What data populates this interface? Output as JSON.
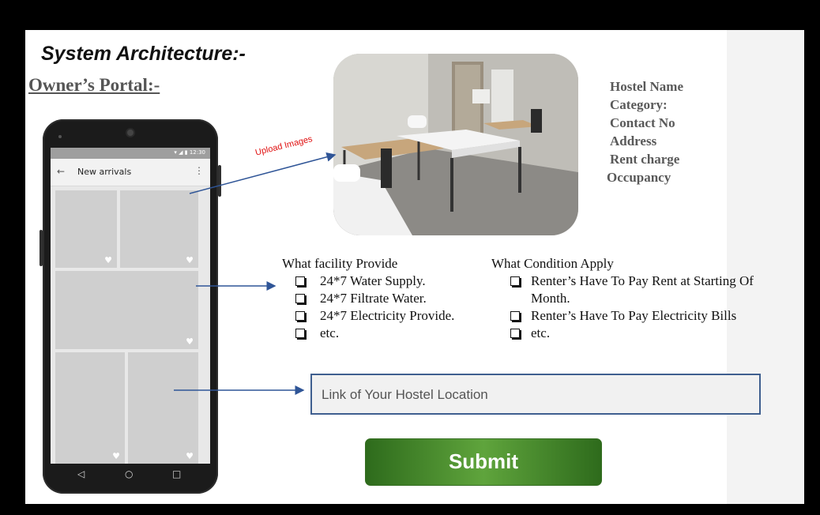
{
  "slide": {
    "heading": "System Architecture:-",
    "subheading": "Owner’s Portal:-"
  },
  "phone": {
    "status_time": "12:30",
    "appbar_title": "New arrivals",
    "back_icon": "arrow-left-icon",
    "more_icon": "more-vertical-icon"
  },
  "upload_label": "Upload Images",
  "hostel_details": [
    "Hostel Name",
    "Category:",
    "Contact No",
    "Address",
    "Rent charge",
    "Occupancy"
  ],
  "facility": {
    "title": "What facility Provide",
    "items": [
      "24*7 Water Supply.",
      "24*7 Filtrate Water.",
      "24*7 Electricity Provide.",
      "etc."
    ]
  },
  "condition": {
    "title": "What Condition Apply",
    "items": [
      "Renter’s Have To Pay Rent at Starting Of Month.",
      "Renter’s Have To Pay Electricity Bills",
      "etc."
    ]
  },
  "location": {
    "placeholder": "Link of Your Hostel Location"
  },
  "submit": {
    "label": "Submit"
  },
  "colors": {
    "frame": "#000000",
    "arrow": "#2f5597",
    "submit_green": "#4a8a2e",
    "upload_label": "#e01010"
  }
}
